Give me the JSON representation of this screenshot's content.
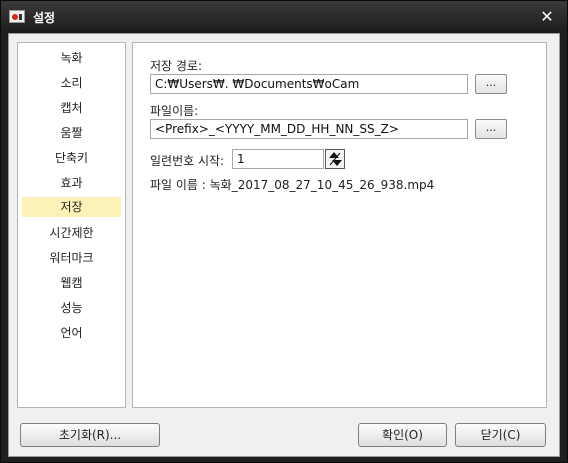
{
  "window": {
    "title": "설정",
    "close": "✕"
  },
  "sidebar": {
    "items": [
      {
        "label": "녹화"
      },
      {
        "label": "소리"
      },
      {
        "label": "캡처"
      },
      {
        "label": "움짤"
      },
      {
        "label": "단축키"
      },
      {
        "label": "효과"
      },
      {
        "label": "저장"
      },
      {
        "label": "시간제한"
      },
      {
        "label": "워터마크"
      },
      {
        "label": "웹캠"
      },
      {
        "label": "성능"
      },
      {
        "label": "언어"
      }
    ],
    "selected": "저장"
  },
  "save": {
    "path_label": "저장 경로:",
    "path_value": "C:₩Users₩.  ₩Documents₩oCam",
    "path_browse": "...",
    "filename_label": "파일이름:",
    "filename_value": "<Prefix>_<YYYY_MM_DD_HH_NN_SS_Z>",
    "filename_browse": "...",
    "serial_label": "일련번호 시작:",
    "serial_value": "1",
    "preview": "파일 이름 : 녹화_2017_08_27_10_45_26_938.mp4"
  },
  "footer": {
    "reset_button": "초기화(R)...",
    "ok_button": "확인(O)",
    "close_button": "닫기(C)"
  }
}
